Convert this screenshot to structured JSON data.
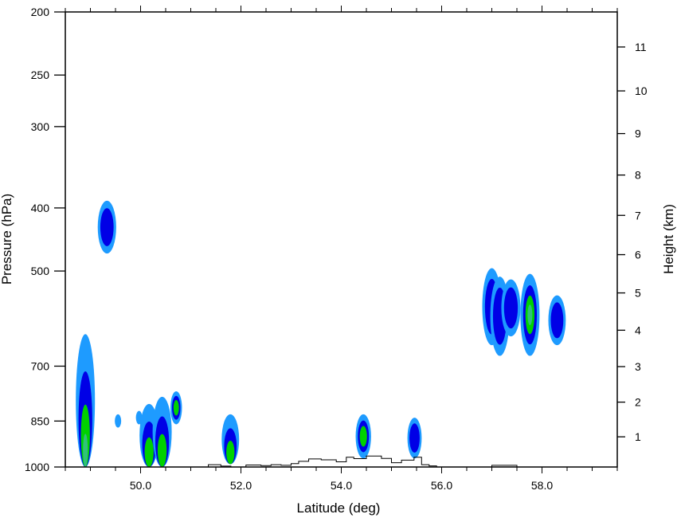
{
  "chart_data": {
    "type": "filled-contour cross-section",
    "xlabel": "Latitude (deg)",
    "ylabel_left": "Pressure (hPa)",
    "ylabel_right": "Height (km)",
    "xlim": [
      48.5,
      59.5
    ],
    "xticks": [
      50.0,
      52.0,
      54.0,
      56.0,
      58.0
    ],
    "xtick_labels": [
      "50.0",
      "52.0",
      "54.0",
      "56.0",
      "58.0"
    ],
    "pressure_axis": {
      "scale": "log",
      "range_hPa": [
        1000,
        200
      ]
    },
    "pressure_ticks": [
      {
        "value": 1000,
        "label": "1000"
      },
      {
        "value": 850,
        "label": "850"
      },
      {
        "value": 700,
        "label": "700"
      },
      {
        "value": 500,
        "label": "500"
      },
      {
        "value": 400,
        "label": "400"
      },
      {
        "value": 300,
        "label": "300"
      },
      {
        "value": 250,
        "label": "250"
      },
      {
        "value": 200,
        "label": "200"
      }
    ],
    "height_ticks": [
      {
        "value": 1,
        "label": "1"
      },
      {
        "value": 2,
        "label": "2"
      },
      {
        "value": 3,
        "label": "3"
      },
      {
        "value": 4,
        "label": "4"
      },
      {
        "value": 5,
        "label": "5"
      },
      {
        "value": 6,
        "label": "6"
      },
      {
        "value": 7,
        "label": "7"
      },
      {
        "value": 8,
        "label": "8"
      },
      {
        "value": 9,
        "label": "9"
      },
      {
        "value": 10,
        "label": "10"
      },
      {
        "value": 11,
        "label": "11"
      }
    ],
    "level_colors": [
      "#1e9bff",
      "#0000e6",
      "#00d200",
      "#31c27a"
    ],
    "cells": [
      {
        "lat": 48.9,
        "base_hPa": 1000,
        "top_hPa": 625,
        "levels": 4
      },
      {
        "lat": 49.33,
        "base_hPa": 470,
        "top_hPa": 390,
        "levels": 2
      },
      {
        "lat": 49.55,
        "base_hPa": 870,
        "top_hPa": 830,
        "levels": 1
      },
      {
        "lat": 49.97,
        "base_hPa": 860,
        "top_hPa": 820,
        "levels": 1
      },
      {
        "lat": 50.17,
        "base_hPa": 1000,
        "top_hPa": 800,
        "levels": 3
      },
      {
        "lat": 50.43,
        "base_hPa": 1000,
        "top_hPa": 780,
        "levels": 3
      },
      {
        "lat": 50.71,
        "base_hPa": 860,
        "top_hPa": 765,
        "levels": 3
      },
      {
        "lat": 51.79,
        "base_hPa": 990,
        "top_hPa": 830,
        "levels": 3
      },
      {
        "lat": 54.44,
        "base_hPa": 970,
        "top_hPa": 830,
        "levels": 3
      },
      {
        "lat": 55.46,
        "base_hPa": 970,
        "top_hPa": 840,
        "levels": 2
      },
      {
        "lat": 57.0,
        "base_hPa": 650,
        "top_hPa": 495,
        "levels": 2
      },
      {
        "lat": 57.16,
        "base_hPa": 675,
        "top_hPa": 510,
        "levels": 2
      },
      {
        "lat": 57.38,
        "base_hPa": 630,
        "top_hPa": 515,
        "levels": 2
      },
      {
        "lat": 57.76,
        "base_hPa": 675,
        "top_hPa": 505,
        "levels": 4
      },
      {
        "lat": 58.3,
        "base_hPa": 650,
        "top_hPa": 545,
        "levels": 2
      }
    ],
    "terrain_profile": {
      "lat": [
        50.95,
        51.35,
        51.6,
        51.8,
        52.1,
        52.4,
        52.6,
        52.8,
        53.0,
        53.15,
        53.35,
        53.6,
        53.9,
        54.1,
        54.25,
        54.5,
        54.8,
        55.0,
        55.2,
        55.45,
        55.6,
        55.75,
        55.9,
        57.0,
        57.5,
        59.5
      ],
      "pressure_hPa": [
        1000,
        992,
        997,
        1000,
        993,
        995,
        992,
        994,
        988,
        980,
        972,
        975,
        982,
        966,
        971,
        962,
        970,
        985,
        976,
        966,
        992,
        996,
        1000,
        994,
        1000,
        1000
      ]
    }
  }
}
